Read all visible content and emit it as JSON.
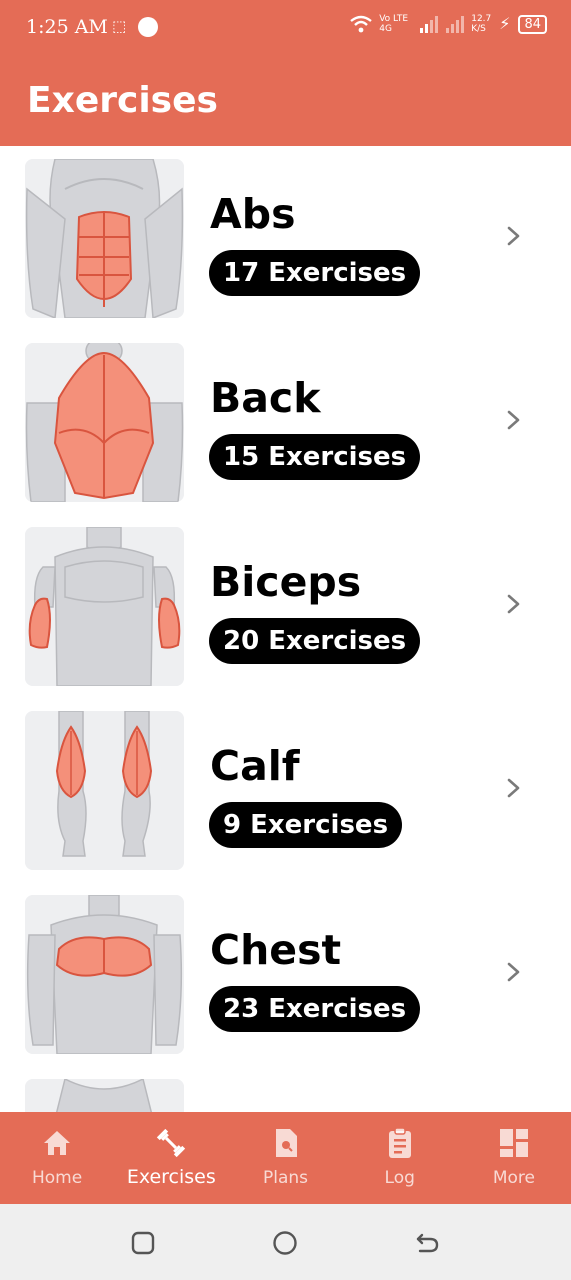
{
  "status": {
    "time": "1:25 AM",
    "sim_icon": "sim-icon",
    "network": "Vo LTE 4G",
    "speed": "12.7 K/S",
    "battery": "84"
  },
  "header": {
    "title": "Exercises"
  },
  "list": {
    "items": [
      {
        "title": "Abs",
        "count": "17 Exercises",
        "muscle": "abs"
      },
      {
        "title": "Back",
        "count": "15 Exercises",
        "muscle": "back"
      },
      {
        "title": "Biceps",
        "count": "20 Exercises",
        "muscle": "biceps"
      },
      {
        "title": "Calf",
        "count": "9 Exercises",
        "muscle": "calf"
      },
      {
        "title": "Chest",
        "count": "23 Exercises",
        "muscle": "chest"
      }
    ]
  },
  "nav": {
    "items": [
      {
        "label": "Home",
        "icon": "home-icon",
        "active": false
      },
      {
        "label": "Exercises",
        "icon": "dumbbell-icon",
        "active": true
      },
      {
        "label": "Plans",
        "icon": "plans-doc-icon",
        "active": false
      },
      {
        "label": "Log",
        "icon": "clipboard-icon",
        "active": false
      },
      {
        "label": "More",
        "icon": "dashboard-icon",
        "active": false
      }
    ]
  },
  "colors": {
    "accent": "#e46c56",
    "muscle_highlight": "#f4907a",
    "muscle_outline": "#d9553f",
    "body_gray": "#d3d4d8"
  }
}
